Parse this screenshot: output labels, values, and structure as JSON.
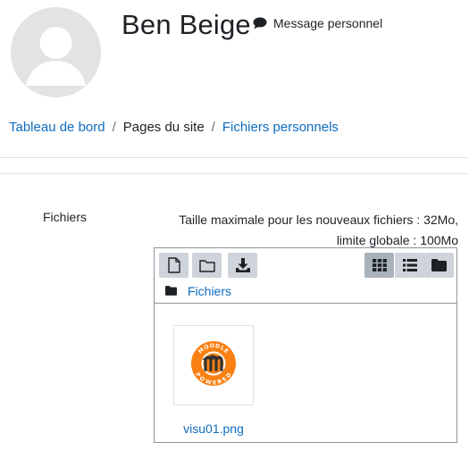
{
  "user": {
    "name": "Ben Beige",
    "message_label": "Message personnel"
  },
  "breadcrumb": {
    "items": [
      {
        "label": "Tableau de bord",
        "link": true
      },
      {
        "label": "Pages du site",
        "link": false
      },
      {
        "label": "Fichiers personnels",
        "link": true
      }
    ],
    "separator": "/"
  },
  "files_section": {
    "label": "Fichiers",
    "limits_line1": "Taille maximale pour les nouveaux fichiers : 32Mo,",
    "limits_line2": "limite globale : 100Mo"
  },
  "filemanager": {
    "toolbar_left": [
      {
        "icon": "file-add-icon"
      },
      {
        "icon": "folder-create-icon"
      },
      {
        "icon": "download-icon"
      }
    ],
    "toolbar_right": [
      {
        "icon": "grid-view-icon",
        "active": true
      },
      {
        "icon": "list-view-icon",
        "active": false
      },
      {
        "icon": "tree-view-icon",
        "active": false
      }
    ],
    "path_label": "Fichiers",
    "files": [
      {
        "name": "visu01.png",
        "thumb_text_top": "MOODLE",
        "thumb_text_bottom": "POWERED"
      }
    ]
  },
  "colors": {
    "link": "#0f6cbf",
    "text": "#1d2125",
    "toolbar_btn": "#ced4da",
    "toolbar_btn_active": "#a9b1ba",
    "moodle_orange": "#f98012"
  }
}
